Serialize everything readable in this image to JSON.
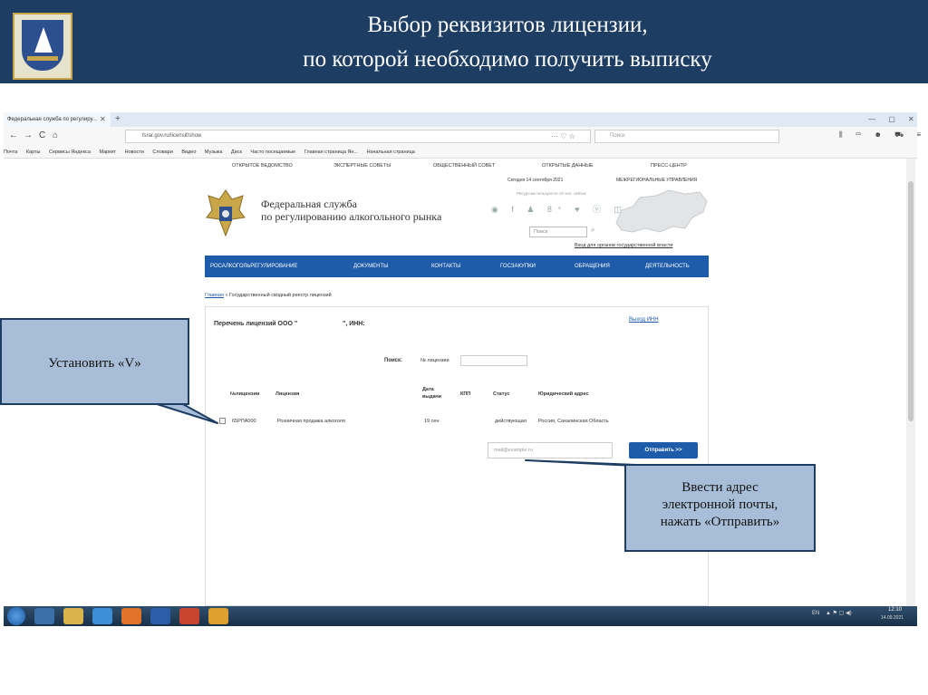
{
  "slide": {
    "title_line1": "Выбор реквизитов лицензии,",
    "title_line2": "по которой необходимо получить выписку"
  },
  "browser": {
    "tab_title": "Федеральная служба по регулиру...",
    "tab_close": "✕",
    "new_tab": "+",
    "window_controls": "— ▢ ✕",
    "nav_back": "←",
    "nav_forward": "→",
    "nav_reload": "C",
    "nav_home": "⌂",
    "url": "fsrar.gov.ru/licensif/show",
    "url_actions": "··· ♡ ☆",
    "search_placeholder": "Поиск",
    "right_icons": "⫼ ▭ ☻ ⛟ ≡",
    "bookmarks": [
      "Почта",
      "Карты",
      "Сервисы Яндекса",
      "Маркет",
      "Новости",
      "Словари",
      "Видео",
      "Музыка",
      "Диск",
      "Часто посещаемые",
      "Главная страница Ян...",
      "Начальная страница"
    ]
  },
  "site": {
    "top_menu": [
      "ОТКРЫТОЕ ВЕДОМСТВО",
      "ЭКСПЕРТНЫЕ СОВЕТЫ",
      "ОБЩЕСТВЕННЫЙ СОВЕТ",
      "ОТКРЫТЫЕ ДАННЫЕ",
      "ПРЕСС-ЦЕНТР"
    ],
    "date_line": "Сегодня 14 сентября 2021",
    "regions_label": "МЕЖРЕГИОНАЛЬНЫЕ УПРАВЛЕНИЯ",
    "org_name_line1": "Федеральная служба",
    "org_name_line2": "по регулированию алкогольного рынка",
    "viewers_line": "Ресурсом пользуются 19 чел. сейчас",
    "social_icons": "◉ f ♟ 8⁺ ♥ ⓥ ◫",
    "search_placeholder": "Поиск",
    "agencies_link": "Вход для органов государственной власти",
    "main_nav": [
      "РОСАЛКОГОЛЬРЕГУЛИРОВАНИЕ",
      "ДОКУМЕНТЫ",
      "КОНТАКТЫ",
      "ГОСЗАКУПКИ",
      "ОБРАЩЕНИЯ",
      "ДЕЯТЕЛЬНОСТЬ"
    ],
    "breadcrumb_home": "Главная",
    "breadcrumb_current": "» Государственный сводный реестр лицензий",
    "license_list": {
      "title": "Перечень лицензий ООО \"",
      "inn_label": "\", ИНН:",
      "logout": "Выход ИНН",
      "search_label": "Поиск:",
      "license_no_label": "№ лицензии",
      "columns": [
        "№лицензии",
        "Лицензия",
        "Дата выдачи",
        "КПП",
        "Статус",
        "Юридический адрес"
      ],
      "rows": [
        {
          "number": "65РПА000",
          "license": "Розничная продажа алкоголя",
          "issue_date": "19 сен",
          "kpp": "",
          "status": "действующая",
          "address": "Россия, Сахалинская Область"
        }
      ],
      "email_placeholder": "mail@example.ru",
      "send_button": "Отправить >>"
    }
  },
  "callouts": {
    "left": "Установить «V»",
    "right_line1": "Ввести адрес",
    "right_line2": "электронной почты,",
    "right_line3": "нажать «Отправить»"
  },
  "taskbar": {
    "language": "EN",
    "tray_icons": "▲ ⚑ ▢ ◀)",
    "time": "12:10",
    "date": "14.09.2021"
  },
  "colors": {
    "header_bg": "#1d3d63",
    "callout_bg": "#a8bed8",
    "site_nav": "#1e5ba8"
  }
}
